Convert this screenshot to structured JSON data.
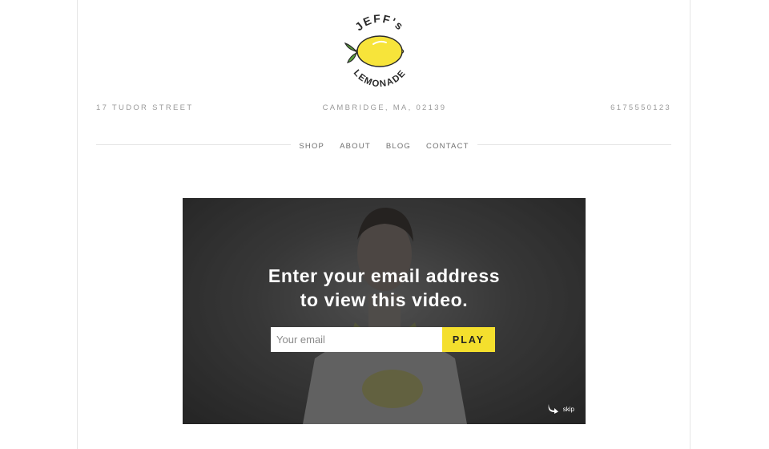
{
  "brand": {
    "logo_text_top": "JEFF's",
    "logo_text_bottom": "LEMONADE"
  },
  "header": {
    "address": "17 TUDOR STREET",
    "city": "CAMBRIDGE, MA, 02139",
    "phone": "6175550123"
  },
  "nav": {
    "items": [
      {
        "label": "SHOP"
      },
      {
        "label": "ABOUT"
      },
      {
        "label": "BLOG"
      },
      {
        "label": "CONTACT"
      }
    ]
  },
  "video_gate": {
    "headline_line1": "Enter your email address",
    "headline_line2": "to view this video.",
    "email_placeholder": "Your email",
    "email_value": "",
    "play_label": "PLAY",
    "skip_label": "skip"
  },
  "colors": {
    "accent_yellow": "#f4df2d",
    "lemon": "#f7e43a",
    "leaf": "#5aa33a",
    "text_muted": "#9a9a9a"
  },
  "icons": [
    "lemon-logo-icon",
    "skip-arrow-icon"
  ]
}
